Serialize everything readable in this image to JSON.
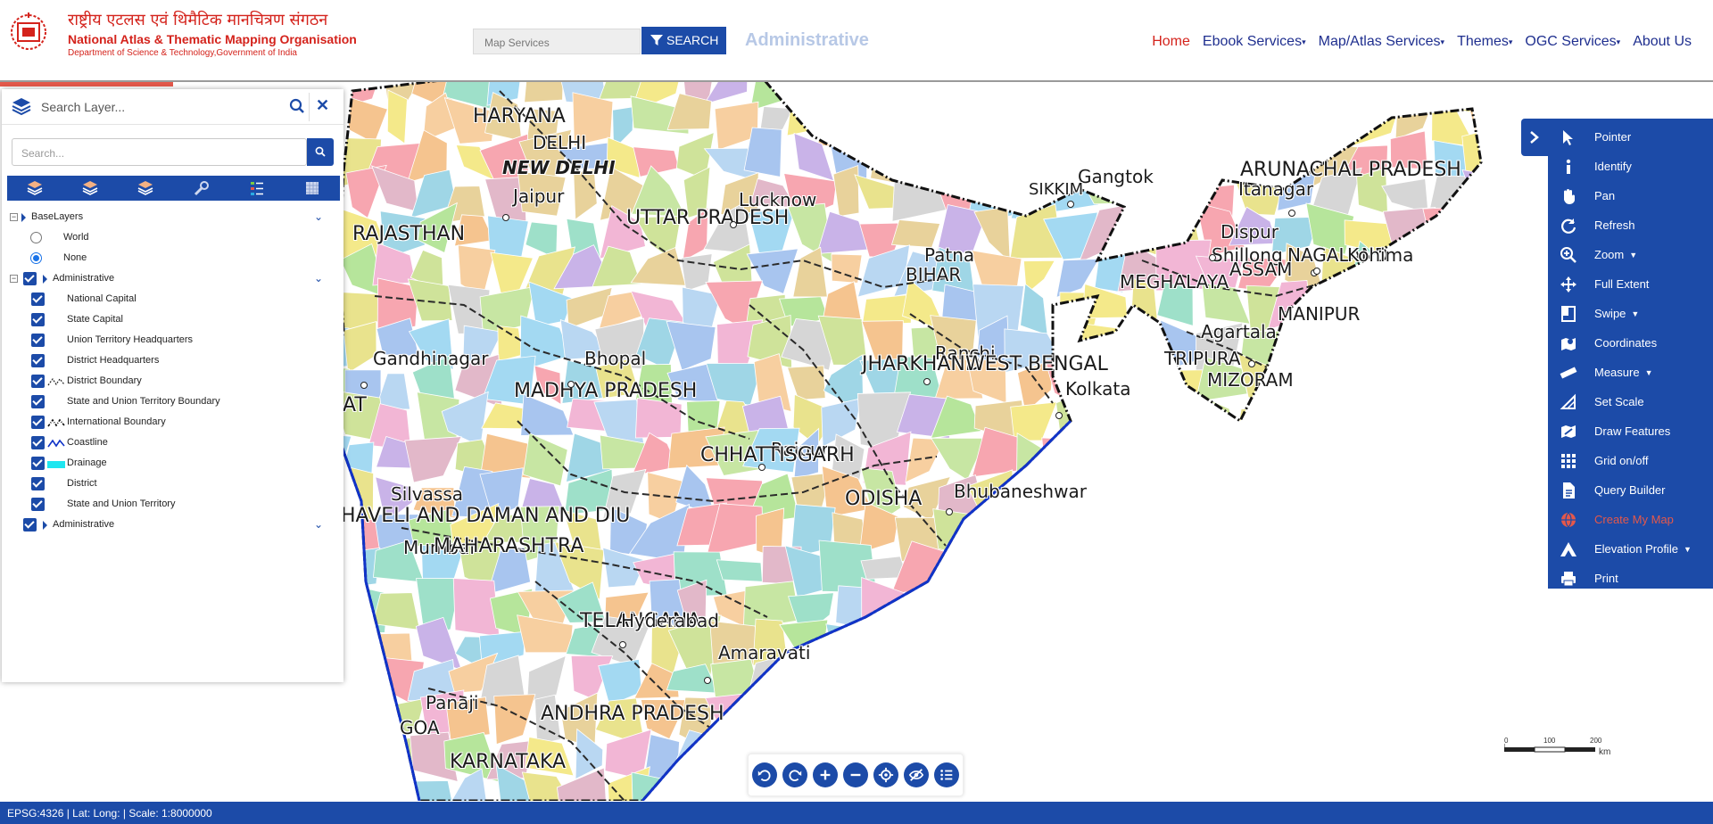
{
  "header": {
    "org_hindi": "राष्ट्रीय एटलस एवं थिमैटिक मानचित्रण संगठन",
    "org_english": "National Atlas & Thematic Mapping Organisation",
    "org_dept": "Department of Science & Technology,Government of India",
    "search_placeholder": "Map Services",
    "search_button": "SEARCH",
    "page_heading": "Administrative",
    "nav": [
      {
        "label": "Home",
        "active": true,
        "dropdown": false
      },
      {
        "label": "Ebook Services",
        "active": false,
        "dropdown": true
      },
      {
        "label": "Map/Atlas Services",
        "active": false,
        "dropdown": true
      },
      {
        "label": "Themes",
        "active": false,
        "dropdown": true
      },
      {
        "label": "OGC Services",
        "active": false,
        "dropdown": true
      },
      {
        "label": "About Us",
        "active": false,
        "dropdown": false
      }
    ]
  },
  "layer_panel": {
    "search_placeholder": "Search Layer...",
    "filter_placeholder": "Search...",
    "toolbar_icons": [
      "layer-stack-icon",
      "layer-stack-icon",
      "layer-stack-icon",
      "wrench-icon",
      "legend-list-icon",
      "grid-pattern-icon"
    ],
    "tree": {
      "baselayers": {
        "label": "BaseLayers",
        "options": [
          {
            "label": "World",
            "selected": false
          },
          {
            "label": "None",
            "selected": true
          }
        ]
      },
      "admin_group": {
        "label": "Administrative",
        "checked": true
      },
      "admin_layers": [
        {
          "label": "National Capital",
          "checked": true,
          "symbol": ""
        },
        {
          "label": "State Capital",
          "checked": true,
          "symbol": ""
        },
        {
          "label": "Union Territory Headquarters",
          "checked": true,
          "symbol": ""
        },
        {
          "label": "District Headquarters",
          "checked": true,
          "symbol": ""
        },
        {
          "label": "District Boundary",
          "checked": true,
          "symbol": "dashed-line"
        },
        {
          "label": "State and Union Territory Boundary",
          "checked": true,
          "symbol": ""
        },
        {
          "label": "International Boundary",
          "checked": true,
          "symbol": "dash-dot-line"
        },
        {
          "label": "Coastline",
          "checked": true,
          "symbol": "blue-line"
        },
        {
          "label": "Drainage",
          "checked": true,
          "symbol": "cyan-fill"
        },
        {
          "label": "District",
          "checked": true,
          "symbol": ""
        },
        {
          "label": "State and Union Territory",
          "checked": true,
          "symbol": ""
        }
      ],
      "admin_group2": {
        "label": "Administrative",
        "checked": true
      }
    }
  },
  "tools": [
    {
      "label": "Pointer",
      "icon": "pointer-icon",
      "dropdown": false,
      "highlight": false
    },
    {
      "label": "Identify",
      "icon": "info-icon",
      "dropdown": false,
      "highlight": false
    },
    {
      "label": "Pan",
      "icon": "hand-icon",
      "dropdown": false,
      "highlight": false
    },
    {
      "label": "Refresh",
      "icon": "refresh-icon",
      "dropdown": false,
      "highlight": false
    },
    {
      "label": "Zoom",
      "icon": "zoom-icon",
      "dropdown": true,
      "highlight": false
    },
    {
      "label": "Full Extent",
      "icon": "move-arrows-icon",
      "dropdown": false,
      "highlight": false
    },
    {
      "label": "Swipe",
      "icon": "swipe-icon",
      "dropdown": true,
      "highlight": false
    },
    {
      "label": "Coordinates",
      "icon": "map-marker-icon",
      "dropdown": false,
      "highlight": false
    },
    {
      "label": "Measure",
      "icon": "ruler-icon",
      "dropdown": true,
      "highlight": false
    },
    {
      "label": "Set Scale",
      "icon": "set-scale-icon",
      "dropdown": false,
      "highlight": false
    },
    {
      "label": "Draw Features",
      "icon": "draw-map-icon",
      "dropdown": false,
      "highlight": false
    },
    {
      "label": "Grid on/off",
      "icon": "grid-icon",
      "dropdown": false,
      "highlight": false
    },
    {
      "label": "Query Builder",
      "icon": "document-icon",
      "dropdown": false,
      "highlight": false
    },
    {
      "label": "Create My Map",
      "icon": "globe-icon",
      "dropdown": false,
      "highlight": true
    },
    {
      "label": "Elevation Profile",
      "icon": "mountain-icon",
      "dropdown": true,
      "highlight": false
    },
    {
      "label": "Print",
      "icon": "print-icon",
      "dropdown": false,
      "highlight": false
    }
  ],
  "map": {
    "labels": [
      {
        "text": "HARYANA",
        "size": 22
      },
      {
        "text": "DELHI",
        "size": 20
      },
      {
        "text": "NEW DELHI",
        "size": 20,
        "italic": true
      },
      {
        "text": "Jaipur",
        "size": 20
      },
      {
        "text": "RAJASTHAN",
        "size": 22
      },
      {
        "text": "UTTAR PRADESH",
        "size": 22
      },
      {
        "text": "Lucknow",
        "size": 20
      },
      {
        "text": "Gangtok",
        "size": 20
      },
      {
        "text": "SIKKIM",
        "size": 18
      },
      {
        "text": "ARUNACHAL PRADESH",
        "size": 22
      },
      {
        "text": "Itanagar",
        "size": 20
      },
      {
        "text": "Dispur",
        "size": 20
      },
      {
        "text": "Shillong",
        "size": 20
      },
      {
        "text": "NAGALAND",
        "size": 20
      },
      {
        "text": "Kohima",
        "size": 20
      },
      {
        "text": "ASSAM",
        "size": 20
      },
      {
        "text": "MEGHALAYA",
        "size": 20
      },
      {
        "text": "MANIPUR",
        "size": 20
      },
      {
        "text": "Agartala",
        "size": 20
      },
      {
        "text": "TRIPURA",
        "size": 20
      },
      {
        "text": "MIZORAM",
        "size": 20
      },
      {
        "text": "Patna",
        "size": 20
      },
      {
        "text": "BIHAR",
        "size": 20
      },
      {
        "text": "Ranchi",
        "size": 20
      },
      {
        "text": "JHARKHAND",
        "size": 22
      },
      {
        "text": "WEST BENGAL",
        "size": 22
      },
      {
        "text": "Kolkata",
        "size": 20
      },
      {
        "text": "Gandhinagar",
        "size": 20
      },
      {
        "text": "Bhopal",
        "size": 20
      },
      {
        "text": "MADHYA PRADESH",
        "size": 22
      },
      {
        "text": "AT",
        "size": 22
      },
      {
        "text": "Raipur",
        "size": 20
      },
      {
        "text": "CHHATTISGARH",
        "size": 22
      },
      {
        "text": "Bhubaneshwar",
        "size": 20
      },
      {
        "text": "ODISHA",
        "size": 22
      },
      {
        "text": "Silvassa",
        "size": 20
      },
      {
        "text": "HAVELI AND DAMAN AND DIU",
        "size": 22
      },
      {
        "text": "Mumbai",
        "size": 20
      },
      {
        "text": "MAHARASHTRA",
        "size": 22
      },
      {
        "text": "TELANGANA",
        "size": 22
      },
      {
        "text": "Hyderabad",
        "size": 20
      },
      {
        "text": "Amaravati",
        "size": 20
      },
      {
        "text": "Panaji",
        "size": 20
      },
      {
        "text": "GOA",
        "size": 20
      },
      {
        "text": "ANDHRA PRADESH",
        "size": 22
      },
      {
        "text": "KARNATAKA",
        "size": 22
      }
    ],
    "controls": [
      "undo-icon",
      "redo-icon",
      "zoom-in-icon",
      "zoom-out-icon",
      "locate-icon",
      "hide-icon",
      "list-icon"
    ],
    "scale": {
      "ticks": [
        "0",
        "100",
        "200"
      ],
      "unit": "km"
    }
  },
  "status": {
    "text": "EPSG:4326 | Lat: Long: | Scale: 1:8000000"
  },
  "colors": {
    "primary": "#1c4ba8",
    "accent_red": "#d4231c",
    "heading_light": "#b7c8e6"
  }
}
